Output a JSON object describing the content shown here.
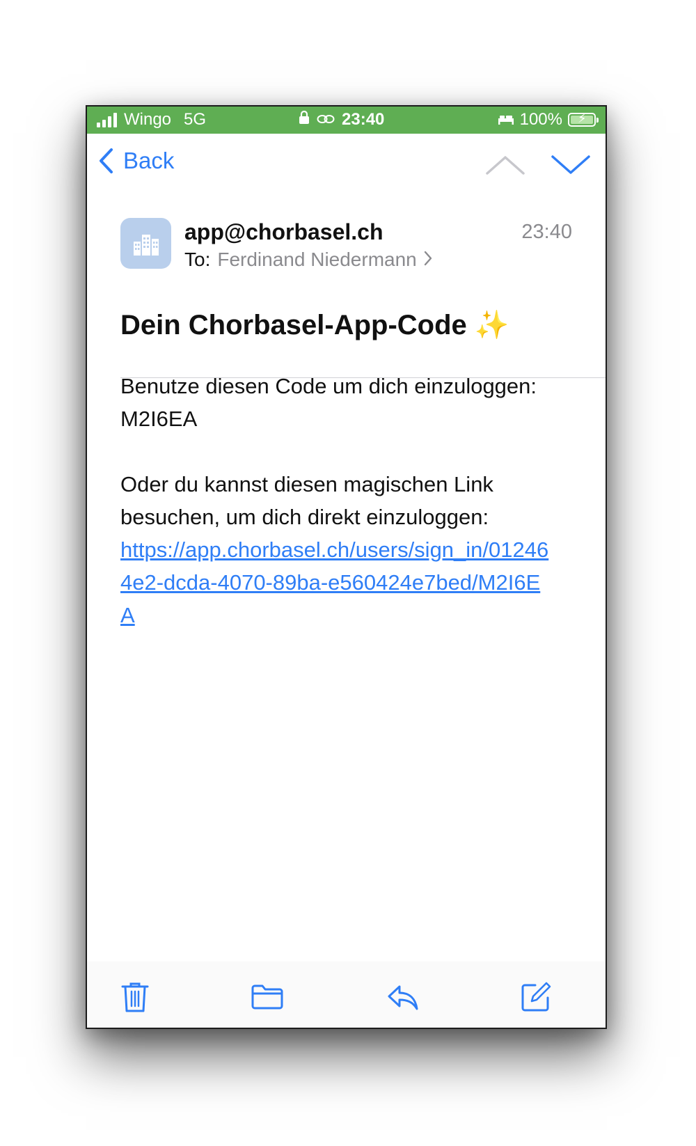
{
  "status_bar": {
    "carrier": "Wingo",
    "network": "5G",
    "time": "23:40",
    "battery": "100%",
    "background_color": "#5fae53"
  },
  "nav": {
    "back_label": "Back",
    "icons": [
      "chevron-left-icon",
      "chevron-up-icon",
      "chevron-down-icon"
    ],
    "accent_color": "#2f7ef6"
  },
  "header": {
    "sender": "app@chorbasel.ch",
    "time": "23:40",
    "to_label": "To:",
    "recipient": "Ferdinand Niedermann",
    "avatar_icon": "buildings-icon"
  },
  "message": {
    "subject": "Dein Chorbasel-App-Code",
    "subject_emoji": "✨",
    "paragraph1": "Benutze diesen Code um dich einzuloggen: M2I6EA",
    "paragraph2": "Oder du kannst diesen magischen Link besuchen, um dich direkt einzuloggen:",
    "link": "https://app.chorbasel.ch/users/sign_in/012464e2-dcda-4070-89ba-e560424e7bed/M2I6EA"
  },
  "toolbar": {
    "icons": [
      "trash-icon",
      "folder-icon",
      "reply-icon",
      "compose-icon"
    ]
  }
}
